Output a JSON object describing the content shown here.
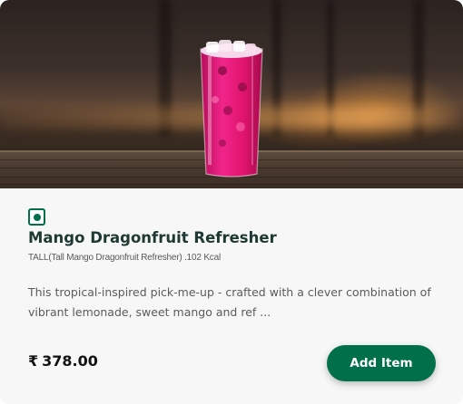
{
  "product": {
    "image_alt": "Mango Dragonfruit Refresher drink",
    "diet_icon": "veg-indicator-icon",
    "name": "Mango Dragonfruit Refresher",
    "size_info": "TALL(Tall Mango Dragonfruit Refresher) .102 Kcal",
    "description": "This tropical-inspired pick-me-up - crafted with a clever combination of vibrant lemonade, sweet mango and ref ...",
    "currency_symbol": "₹",
    "price": "378.00"
  },
  "actions": {
    "add_label": "Add Item"
  },
  "colors": {
    "brand_green": "#00704a",
    "title_green": "#1e3932",
    "drink_magenta": "#e0146e"
  }
}
